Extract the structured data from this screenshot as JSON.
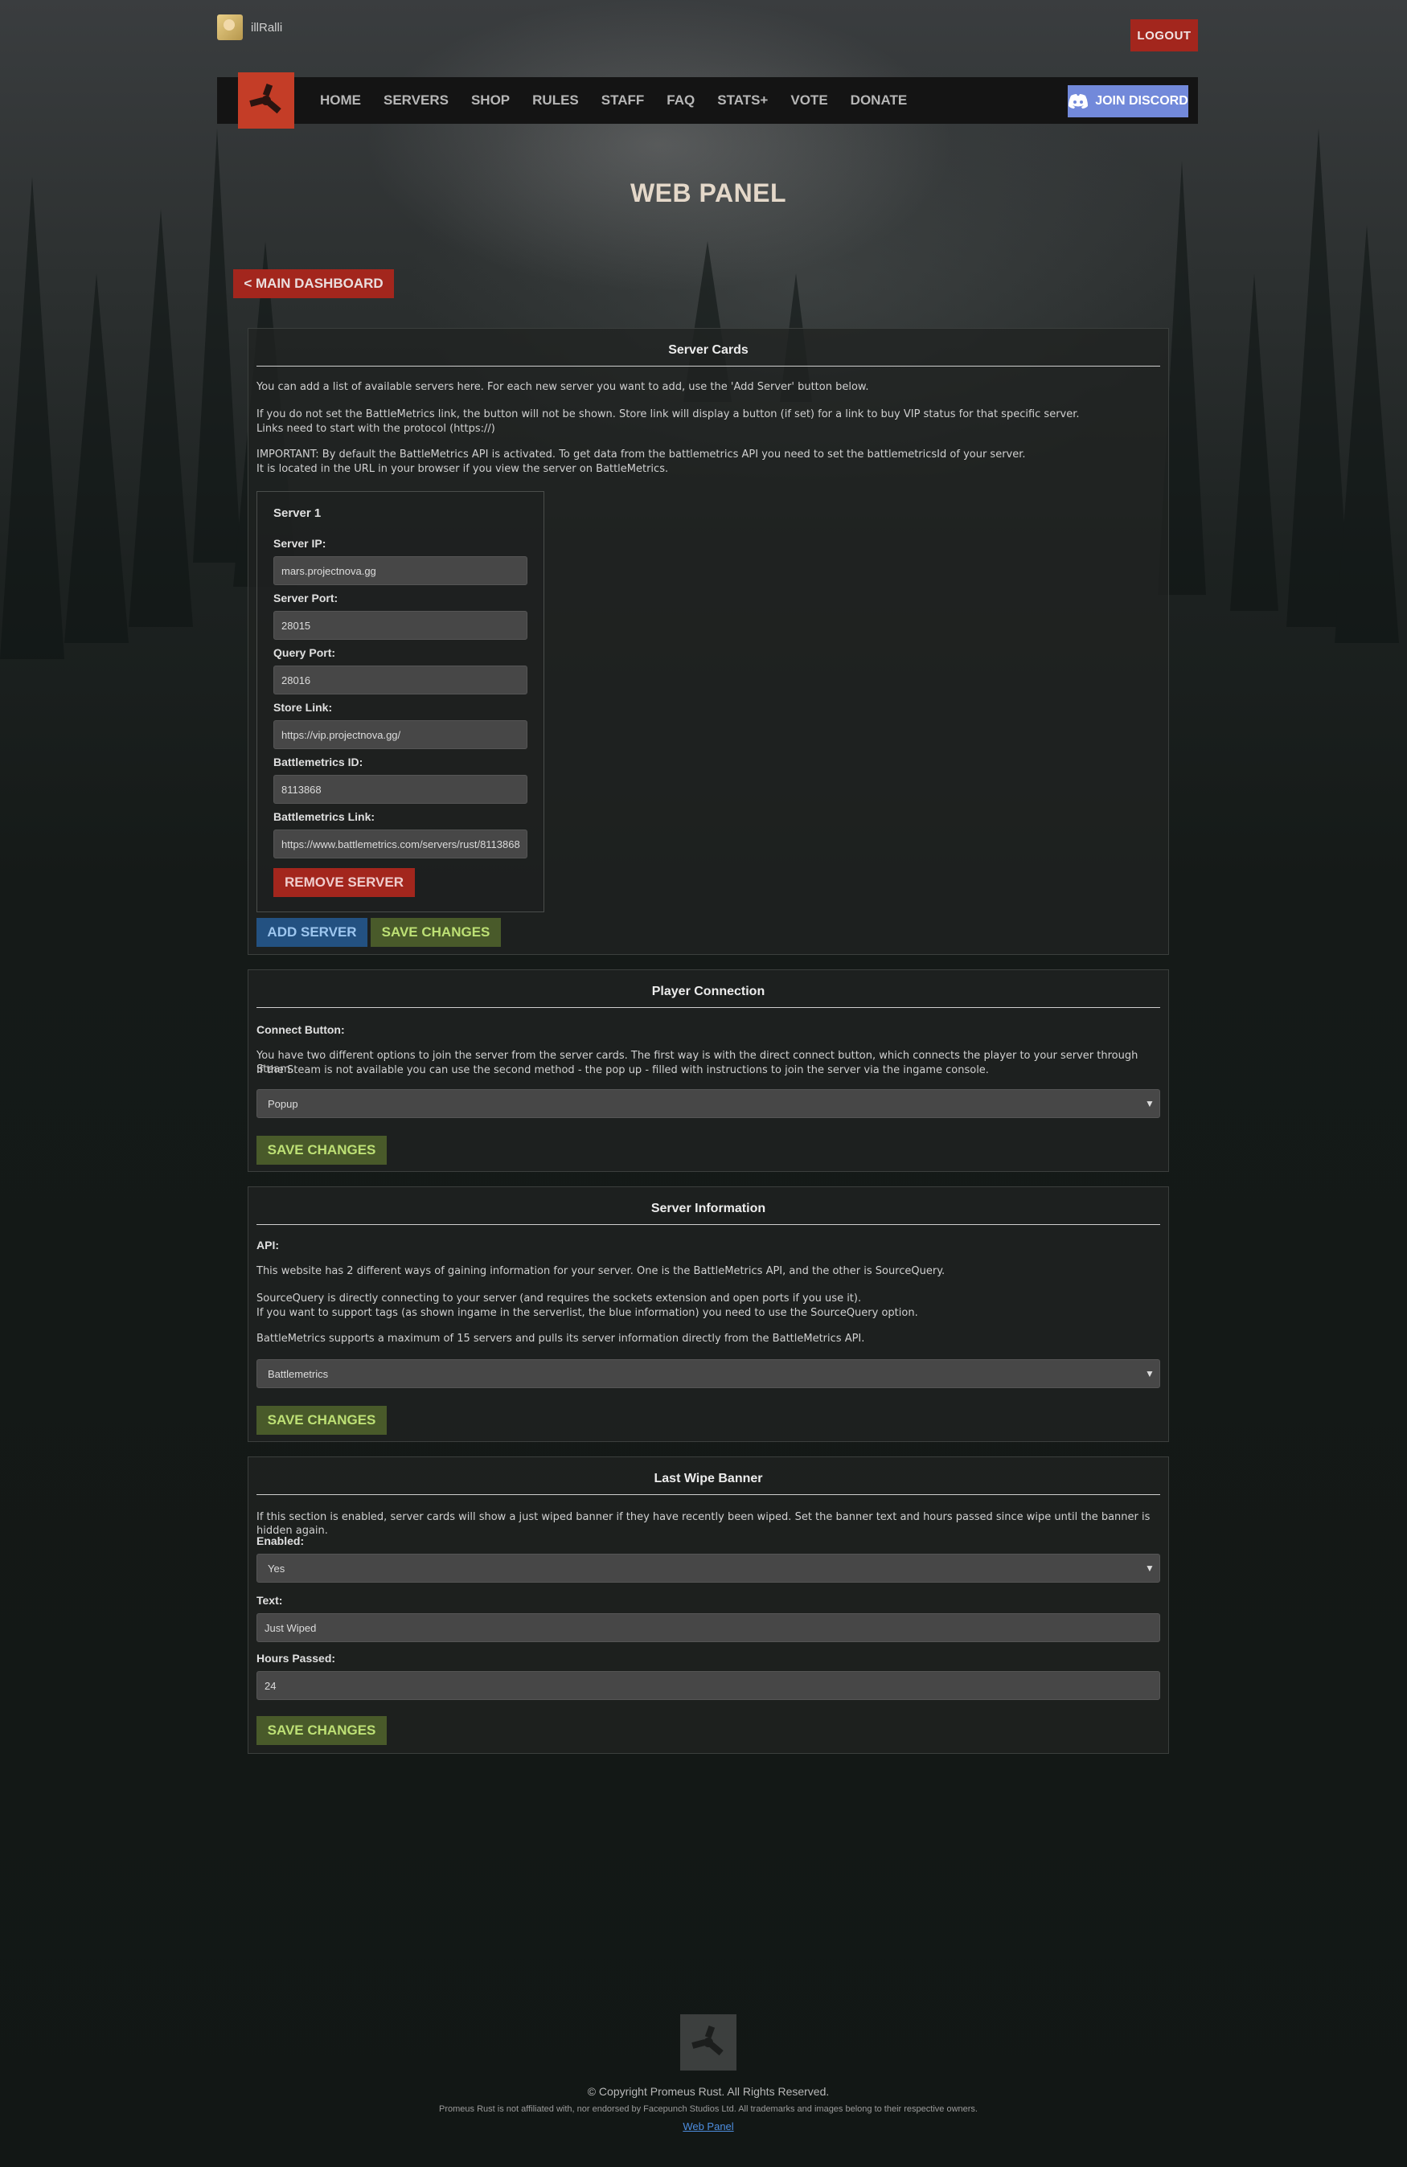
{
  "user": {
    "name": "illRalli",
    "logout_label": "LOGOUT"
  },
  "nav": {
    "items": [
      "HOME",
      "SERVERS",
      "SHOP",
      "RULES",
      "STAFF",
      "FAQ",
      "STATS+",
      "VOTE",
      "DONATE"
    ],
    "discord_label": "JOIN DISCORD"
  },
  "page": {
    "title": "WEB PANEL",
    "back_label": "< MAIN DASHBOARD"
  },
  "server_cards": {
    "title": "Server Cards",
    "p1": "You can add a list of available servers here. For each new server you want to add, use the 'Add Server' button below.",
    "p2a": "If you do not set the BattleMetrics link, the button will not be shown. Store link will display a button (if set) for a link to buy VIP status for that specific server.",
    "p2b": "Links need to start with the protocol (https://)",
    "p3a": "IMPORTANT: By default the BattleMetrics API is activated. To get data from the battlemetrics API you need to set the battlemetricsId of your server.",
    "p3b": "It is located in the URL in your browser if you view the server on BattleMetrics.",
    "server": {
      "heading": "Server 1",
      "ip_label": "Server IP:",
      "ip": "mars.projectnova.gg",
      "port_label": "Server Port:",
      "port": "28015",
      "query_label": "Query Port:",
      "query": "28016",
      "store_label": "Store Link:",
      "store": "https://vip.projectnova.gg/",
      "bmid_label": "Battlemetrics ID:",
      "bmid": "8113868",
      "bmlink_label": "Battlemetrics Link:",
      "bmlink": "https://www.battlemetrics.com/servers/rust/8113868",
      "remove_label": "REMOVE SERVER"
    },
    "add_label": "ADD SERVER",
    "save_label": "SAVE CHANGES"
  },
  "player_connection": {
    "title": "Player Connection",
    "label": "Connect Button:",
    "p1": "You have two different options to join the server from the server cards. The first way is with the direct connect button, which connects the player to your server through Steam.",
    "p2": "If the Steam is not available you can use the second method - the pop up - filled with instructions to join the server via the ingame console.",
    "select": "Popup",
    "save_label": "SAVE CHANGES"
  },
  "server_info": {
    "title": "Server Information",
    "label": "API:",
    "p1": "This website has 2 different ways of gaining information for your server. One is the BattleMetrics API, and the other is SourceQuery.",
    "p2a": "SourceQuery is directly connecting to your server (and requires the sockets extension and open ports if you use it).",
    "p2b": "If you want to support tags (as shown ingame in the serverlist, the blue information) you need to use the SourceQuery option.",
    "p3": "BattleMetrics supports a maximum of 15 servers and pulls its server information directly from the BattleMetrics API.",
    "select": "Battlemetrics",
    "save_label": "SAVE CHANGES"
  },
  "wipe_banner": {
    "title": "Last Wipe Banner",
    "p1": "If this section is enabled, server cards will show a just wiped banner if they have recently been wiped. Set the banner text and hours passed since wipe until the banner is hidden again.",
    "enabled_label": "Enabled:",
    "enabled": "Yes",
    "text_label": "Text:",
    "text": "Just Wiped",
    "hours_label": "Hours Passed:",
    "hours": "24",
    "save_label": "SAVE CHANGES"
  },
  "footer": {
    "copyright": "© Copyright Promeus Rust. All Rights Reserved.",
    "disclaimer": "Promeus Rust is not affiliated with, nor endorsed by Facepunch Studios Ltd. All trademarks and images belong to their respective owners.",
    "link": "Web Panel"
  },
  "colors": {
    "accent_red": "#a3261d",
    "logo_red": "#c43d27",
    "discord": "#7289da",
    "save_green": "#495a2a",
    "add_blue": "#235181"
  }
}
